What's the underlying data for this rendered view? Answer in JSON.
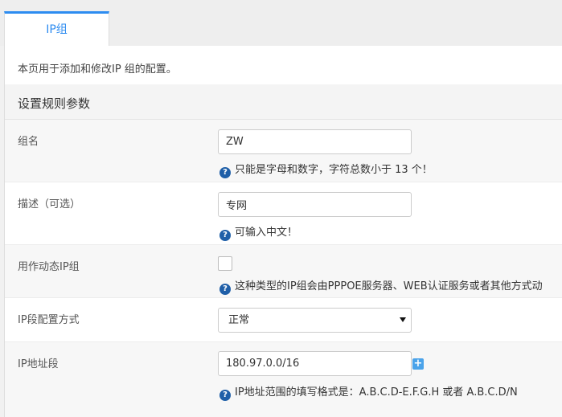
{
  "tabs": [
    {
      "label": "IP组",
      "active": true
    }
  ],
  "page": {
    "description": "本页用于添加和修改IP 组的配置。",
    "section_title": "设置规则参数"
  },
  "form": {
    "group_name": {
      "label": "组名",
      "value": "ZW",
      "help": "只能是字母和数字，字符总数小于 13 个！"
    },
    "description_field": {
      "label": "描述（可选）",
      "value": "专网",
      "help": "可输入中文！"
    },
    "dynamic_ip_group": {
      "label": "用作动态IP组",
      "checked": false,
      "help": "这种类型的IP组会由PPPOE服务器、WEB认证服务或者其他方式动"
    },
    "ip_config_mode": {
      "label": "IP段配置方式",
      "selected": "正常"
    },
    "ip_range": {
      "label": "IP地址段",
      "value": "180.97.0.0/16",
      "add_label": "+",
      "help": "IP地址范围的填写格式是：A.B.C.D-E.F.G.H 或者 A.B.C.D/N"
    }
  },
  "icons": {
    "help_icon_glyph": "?",
    "accent_color": "#2d8cf0",
    "help_icon_color": "#1f5fa8",
    "add_button_color": "#4ba3ea"
  }
}
